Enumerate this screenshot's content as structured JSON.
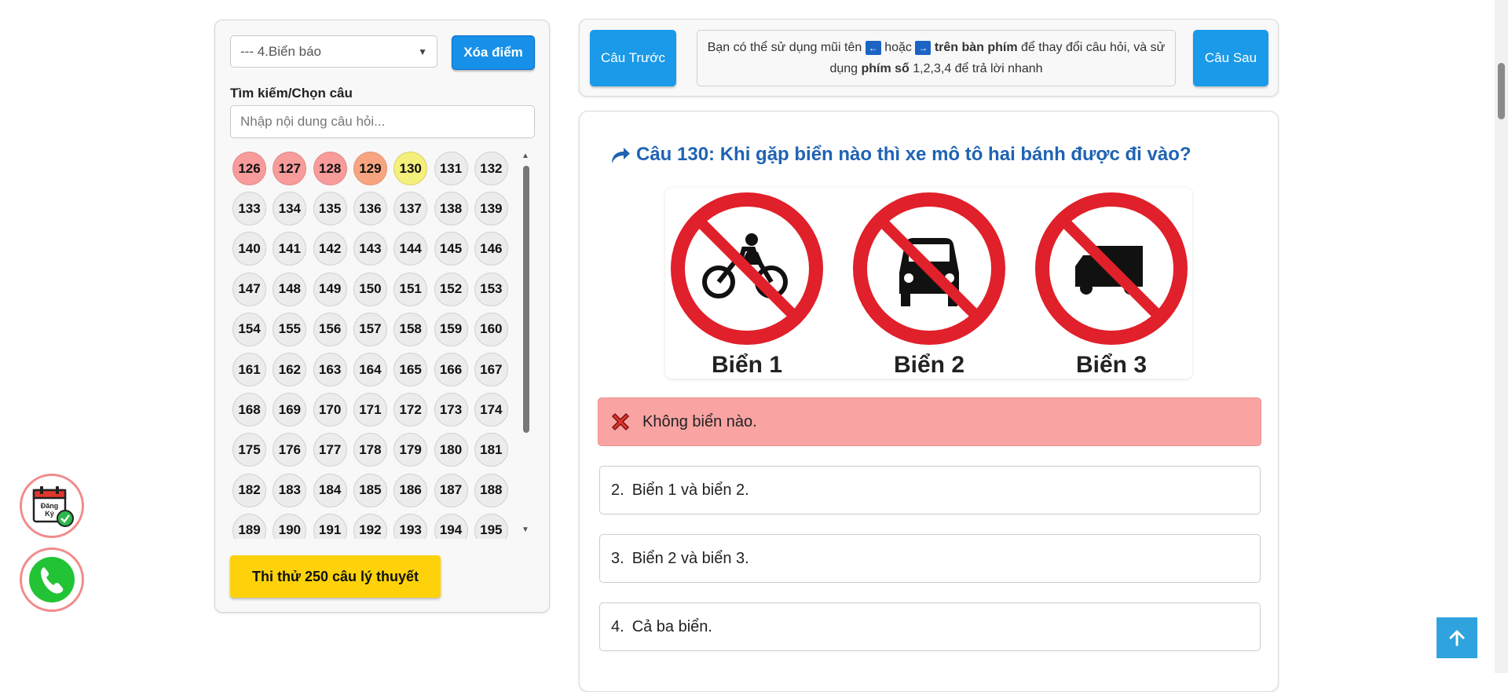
{
  "sidebar": {
    "category_select": "--- 4.Biển báo",
    "clear_button": "Xóa điểm",
    "search_label": "Tìm kiếm/Chọn câu",
    "search_placeholder": "Nhập nội dung câu hỏi...",
    "question_numbers": [
      {
        "num": "126",
        "status": "wrong"
      },
      {
        "num": "127",
        "status": "wrong"
      },
      {
        "num": "128",
        "status": "wrong"
      },
      {
        "num": "129",
        "status": "orange"
      },
      {
        "num": "130",
        "status": "current"
      },
      {
        "num": "131",
        "status": ""
      },
      {
        "num": "132",
        "status": ""
      },
      {
        "num": "133",
        "status": ""
      },
      {
        "num": "134",
        "status": ""
      },
      {
        "num": "135",
        "status": ""
      },
      {
        "num": "136",
        "status": ""
      },
      {
        "num": "137",
        "status": ""
      },
      {
        "num": "138",
        "status": ""
      },
      {
        "num": "139",
        "status": ""
      },
      {
        "num": "140",
        "status": ""
      },
      {
        "num": "141",
        "status": ""
      },
      {
        "num": "142",
        "status": ""
      },
      {
        "num": "143",
        "status": ""
      },
      {
        "num": "144",
        "status": ""
      },
      {
        "num": "145",
        "status": ""
      },
      {
        "num": "146",
        "status": ""
      },
      {
        "num": "147",
        "status": ""
      },
      {
        "num": "148",
        "status": ""
      },
      {
        "num": "149",
        "status": ""
      },
      {
        "num": "150",
        "status": ""
      },
      {
        "num": "151",
        "status": ""
      },
      {
        "num": "152",
        "status": ""
      },
      {
        "num": "153",
        "status": ""
      },
      {
        "num": "154",
        "status": ""
      },
      {
        "num": "155",
        "status": ""
      },
      {
        "num": "156",
        "status": ""
      },
      {
        "num": "157",
        "status": ""
      },
      {
        "num": "158",
        "status": ""
      },
      {
        "num": "159",
        "status": ""
      },
      {
        "num": "160",
        "status": ""
      },
      {
        "num": "161",
        "status": ""
      },
      {
        "num": "162",
        "status": ""
      },
      {
        "num": "163",
        "status": ""
      },
      {
        "num": "164",
        "status": ""
      },
      {
        "num": "165",
        "status": ""
      },
      {
        "num": "166",
        "status": ""
      },
      {
        "num": "167",
        "status": ""
      },
      {
        "num": "168",
        "status": ""
      },
      {
        "num": "169",
        "status": ""
      },
      {
        "num": "170",
        "status": ""
      },
      {
        "num": "171",
        "status": ""
      },
      {
        "num": "172",
        "status": ""
      },
      {
        "num": "173",
        "status": ""
      },
      {
        "num": "174",
        "status": ""
      },
      {
        "num": "175",
        "status": ""
      },
      {
        "num": "176",
        "status": ""
      },
      {
        "num": "177",
        "status": ""
      },
      {
        "num": "178",
        "status": ""
      },
      {
        "num": "179",
        "status": ""
      },
      {
        "num": "180",
        "status": ""
      },
      {
        "num": "181",
        "status": ""
      },
      {
        "num": "182",
        "status": ""
      },
      {
        "num": "183",
        "status": ""
      },
      {
        "num": "184",
        "status": ""
      },
      {
        "num": "185",
        "status": ""
      },
      {
        "num": "186",
        "status": ""
      },
      {
        "num": "187",
        "status": ""
      },
      {
        "num": "188",
        "status": ""
      },
      {
        "num": "189",
        "status": ""
      },
      {
        "num": "190",
        "status": ""
      },
      {
        "num": "191",
        "status": ""
      },
      {
        "num": "192",
        "status": ""
      },
      {
        "num": "193",
        "status": ""
      },
      {
        "num": "194",
        "status": ""
      },
      {
        "num": "195",
        "status": ""
      }
    ],
    "exam_button": "Thi thử 250 câu lý thuyết"
  },
  "nav": {
    "prev_button": "Câu Trước",
    "next_button": "Câu Sau",
    "hint": {
      "part1": "Bạn có thể sử dụng mũi tên",
      "part2": "hoặc",
      "part3": "trên bàn phím",
      "part4": "để thay đổi câu hỏi, và sử dụng",
      "part5": "phím số",
      "part6": "1,2,3,4 để trả lời nhanh",
      "key_left": "←",
      "key_right": "→"
    }
  },
  "question": {
    "title": "Câu 130: Khi gặp biển nào thì xe mô tô hai bánh được đi vào?",
    "image_labels": [
      "Biển 1",
      "Biển 2",
      "Biển 3"
    ],
    "answers": [
      {
        "num": "",
        "text": "Không biển nào.",
        "state": "wrong"
      },
      {
        "num": "2.",
        "text": "Biển 1 và biển 2.",
        "state": ""
      },
      {
        "num": "3.",
        "text": "Biển 2 và biển 3.",
        "state": ""
      },
      {
        "num": "4.",
        "text": "Cả ba biển.",
        "state": ""
      }
    ]
  },
  "floating": {
    "register_icon_text": [
      "Đăng",
      "Ký"
    ],
    "phone_icon": "phone-icon",
    "scroll_top_icon": "arrow-up-icon"
  },
  "colors": {
    "primary_blue": "#1a9ae8",
    "title_blue": "#1f63b3",
    "wrong_red": "#f9a3a3",
    "current_yellow": "#f5ef7c",
    "exam_yellow": "#fdd20a"
  }
}
